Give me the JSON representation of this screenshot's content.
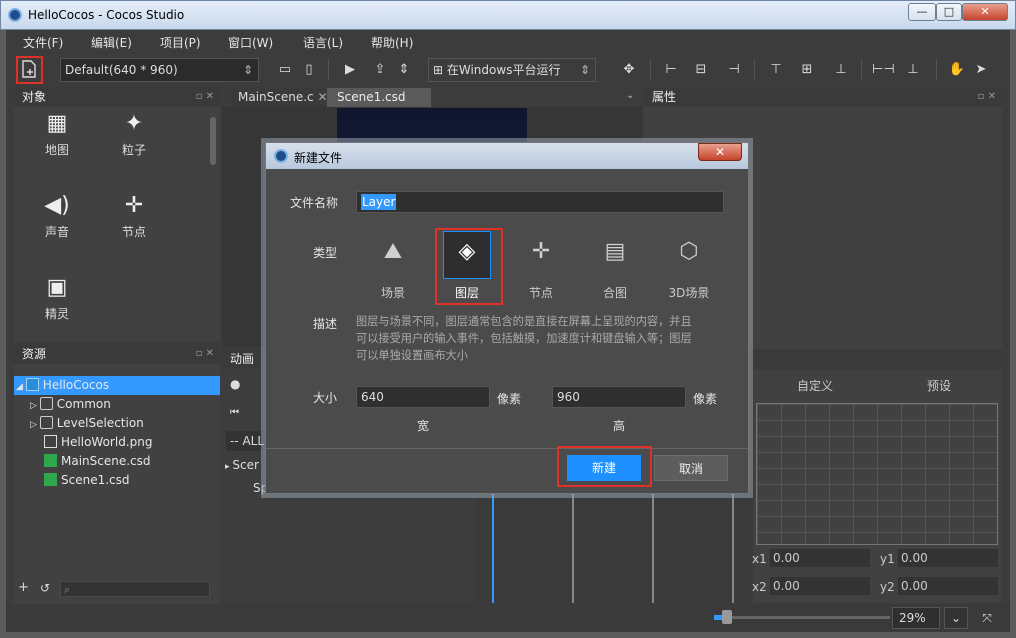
{
  "window": {
    "title": "HelloCocos - Cocos Studio",
    "min": "—",
    "max": "□",
    "close": "✕"
  },
  "menu": [
    "文件(F)",
    "编辑(E)",
    "项目(P)",
    "窗口(W)",
    "语言(L)",
    "帮助(H)"
  ],
  "toolbar": {
    "resolution": "Default(640 * 960)",
    "run_target": "在Windows平台运行"
  },
  "objects_panel": {
    "title": "对象",
    "items": [
      {
        "label": "地图",
        "icon": "map-icon"
      },
      {
        "label": "粒子",
        "icon": "particle-icon"
      },
      {
        "label": "声音",
        "icon": "sound-icon"
      },
      {
        "label": "节点",
        "icon": "node-icon"
      },
      {
        "label": "精灵",
        "icon": "sprite-icon"
      }
    ]
  },
  "resources_panel": {
    "title": "资源",
    "tree": [
      {
        "label": "HelloCocos",
        "selected": true
      },
      {
        "label": "Common"
      },
      {
        "label": "LevelSelection"
      },
      {
        "label": "HelloWorld.png"
      },
      {
        "label": "MainScene.csd"
      },
      {
        "label": "Scene1.csd"
      }
    ]
  },
  "tabs": [
    {
      "label": "MainScene.c"
    },
    {
      "label": "Scene1.csd"
    }
  ],
  "properties_panel": {
    "title": "属性"
  },
  "animation_panel": {
    "title": "动画",
    "filter": "-- ALL",
    "row1": "Scer",
    "row2": "Sp"
  },
  "right_bottom": {
    "tab_custom": "自定义",
    "tab_preset": "预设",
    "x1_label": "x1",
    "x1": "0.00",
    "y1_label": "y1",
    "y1": "0.00",
    "x2_label": "x2",
    "x2": "0.00",
    "y2_label": "y2",
    "y2": "0.00"
  },
  "status": {
    "zoom": "29%"
  },
  "dialog": {
    "title": "新建文件",
    "name_label": "文件名称",
    "name_value": "Layer",
    "type_label": "类型",
    "types": [
      {
        "label": "场景",
        "icon": "scene-icon"
      },
      {
        "label": "图层",
        "icon": "layer-icon",
        "selected": true
      },
      {
        "label": "节点",
        "icon": "node-icon"
      },
      {
        "label": "合图",
        "icon": "sprite-sheet-icon"
      },
      {
        "label": "3D场景",
        "icon": "3d-scene-icon"
      }
    ],
    "desc_label": "描述",
    "desc_lines": [
      "图层与场景不同，图层通常包含的是直接在屏幕上呈现的内容，并且",
      "可以接受用户的输入事件，包括触摸，加速度计和键盘输入等；图层",
      "可以单独设置画布大小"
    ],
    "size_label": "大小",
    "width": "640",
    "height": "960",
    "unit": "像素",
    "width_label": "宽",
    "height_label": "高",
    "create": "新建",
    "cancel": "取消"
  },
  "colors": {
    "accent": "#1e90ff",
    "highlight": "#e0302a",
    "selected": "#3399ff"
  }
}
